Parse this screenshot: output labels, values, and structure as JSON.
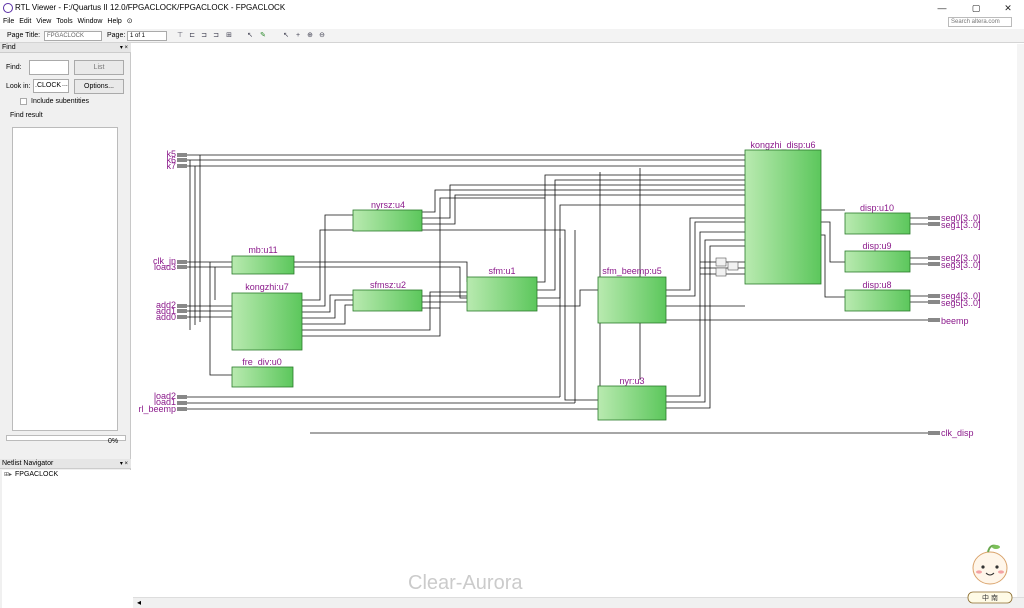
{
  "window": {
    "title": "RTL Viewer - F:/Quartus II 12.0/FPGACLOCK/FPGACLOCK - FPGACLOCK",
    "controls": [
      "—",
      "▢",
      "✕"
    ]
  },
  "menu": [
    "File",
    "Edit",
    "View",
    "Tools",
    "Window",
    "Help"
  ],
  "help_icon": "⊙",
  "search_placeholder": "Search altera.com",
  "toolbar": {
    "page_title_label": "Page Title:",
    "page_title_value": "FPGACLOCK",
    "page_label": "Page:",
    "page_value": "1 of 1"
  },
  "find_panel": {
    "header": "Find",
    "header_controls": "▾ ×",
    "find_label": "Find:",
    "list_button": "List",
    "lookin_label": "Look in:",
    "lookin_value": ".CLOCK",
    "lookin_more": "...",
    "options_button": "Options...",
    "include_subentities": "Include subentities",
    "find_result_label": "Find result",
    "progress": "0%"
  },
  "netlist_navigator": {
    "header": "Netlist Navigator",
    "header_controls": "▾ ×",
    "root_item": "FPGACLOCK"
  },
  "schematic": {
    "inputs": [
      "k5",
      "k6",
      "k7",
      "clk_in",
      "load3",
      "add2",
      "add1",
      "add0",
      "load2",
      "load1",
      "rl_beemp"
    ],
    "outputs": [
      "seg0[3..0]",
      "seg1[3..0]",
      "seg2[3..0]",
      "seg3[3..0]",
      "seg4[3..0]",
      "seg5[3..0]",
      "beemp",
      "clk_disp"
    ],
    "blocks": [
      {
        "id": "mb",
        "title": "mb:u11"
      },
      {
        "id": "kongzhi",
        "title": "kongzhi:u7"
      },
      {
        "id": "frediv",
        "title": "fre_div:u0"
      },
      {
        "id": "nyrsz",
        "title": "nyrsz:u4"
      },
      {
        "id": "sfmsz",
        "title": "sfmsz:u2"
      },
      {
        "id": "sfm",
        "title": "sfm:u1"
      },
      {
        "id": "beemp",
        "title": "sfm_beemp:u5"
      },
      {
        "id": "nyr",
        "title": "nyr:u3"
      },
      {
        "id": "disp6",
        "title": "kongzhi_disp:u6"
      },
      {
        "id": "d10",
        "title": "disp:u10"
      },
      {
        "id": "d9",
        "title": "disp:u9"
      },
      {
        "id": "d8",
        "title": "disp:u8"
      }
    ]
  },
  "watermark": "Clear-Aurora",
  "mascot_label": "中 南",
  "colors": {
    "block_fill": "#66cc66",
    "block_fill_light": "#b9eab0",
    "label_purple": "#8b1a8b",
    "wire": "#000000"
  }
}
